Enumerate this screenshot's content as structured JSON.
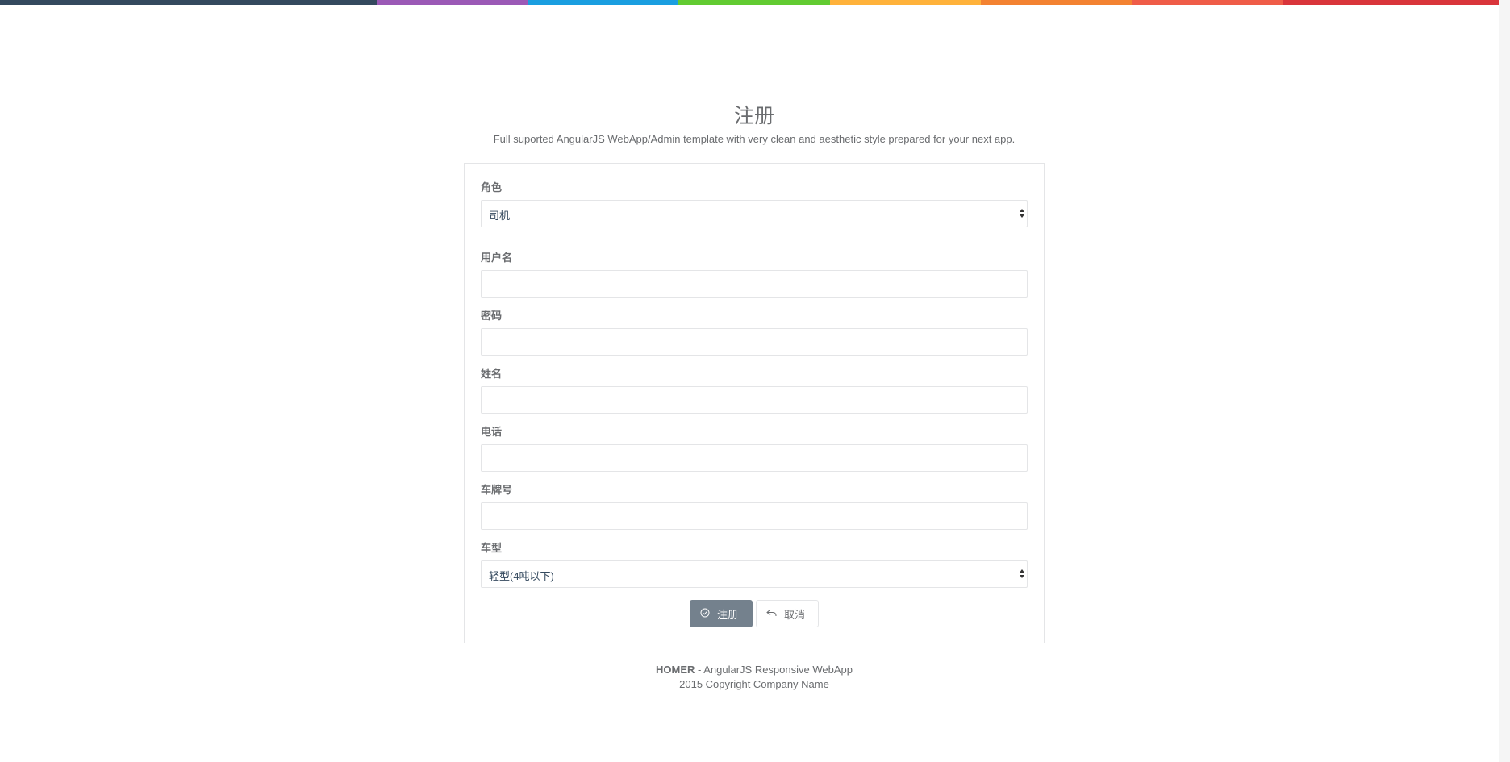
{
  "page": {
    "title": "注册",
    "subtitle": "Full suported AngularJS WebApp/Admin template with very clean and aesthetic style prepared for your next app."
  },
  "color_line": [
    "#34495e",
    "#9b59b6",
    "#3498db",
    "#62cb31",
    "#ffb606",
    "#e67e22",
    "#e74c3c",
    "#c0392b"
  ],
  "form": {
    "role": {
      "label": "角色",
      "value": "司机"
    },
    "username": {
      "label": "用户名",
      "value": "",
      "placeholder": ""
    },
    "password": {
      "label": "密码",
      "value": "",
      "placeholder": ""
    },
    "name": {
      "label": "姓名",
      "value": "",
      "placeholder": ""
    },
    "phone": {
      "label": "电话",
      "value": "",
      "placeholder": ""
    },
    "plate": {
      "label": "车牌号",
      "value": "",
      "placeholder": ""
    },
    "vehicle_type": {
      "label": "车型",
      "value": "轻型(4吨以下)"
    }
  },
  "buttons": {
    "register": {
      "label": "注册",
      "icon": "check-circle-icon"
    },
    "cancel": {
      "label": "取消",
      "icon": "reply-icon"
    }
  },
  "footer": {
    "brand": "HOMER",
    "tagline": " - AngularJS Responsive WebApp",
    "copyright": "2015 Copyright Company Name"
  }
}
